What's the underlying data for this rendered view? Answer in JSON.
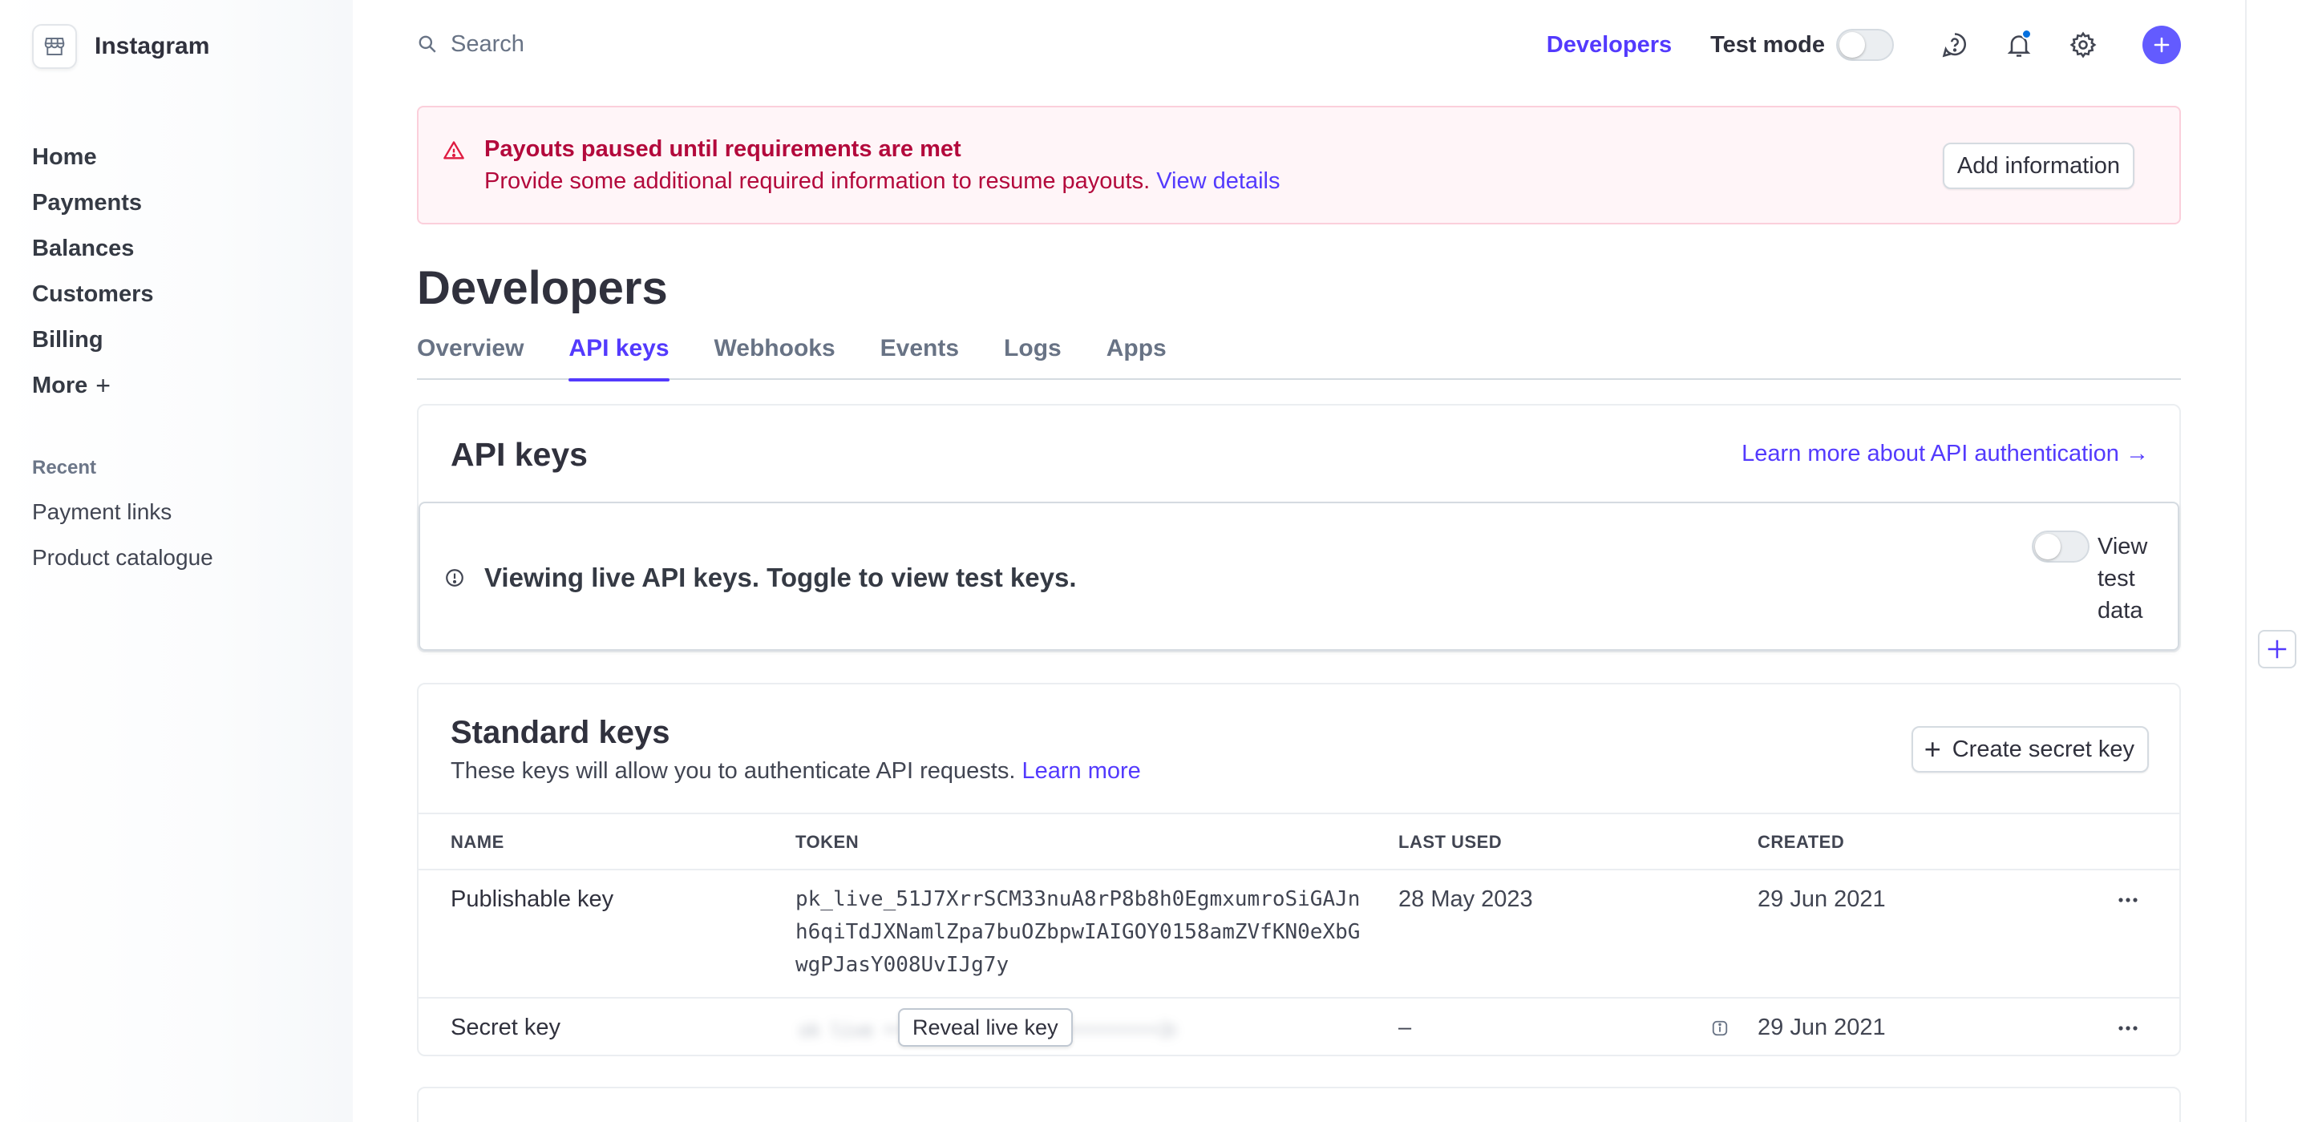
{
  "brand": {
    "name": "Instagram",
    "logo_icon": "store-icon"
  },
  "sidebar": {
    "items": [
      {
        "label": "Home"
      },
      {
        "label": "Payments"
      },
      {
        "label": "Balances"
      },
      {
        "label": "Customers"
      },
      {
        "label": "Billing"
      },
      {
        "label": "More"
      }
    ],
    "more_suffix": "+",
    "recent_label": "Recent",
    "recent": [
      {
        "label": "Payment links"
      },
      {
        "label": "Product catalogue"
      }
    ]
  },
  "topbar": {
    "search_placeholder": "Search",
    "developers_link": "Developers",
    "test_mode_label": "Test mode",
    "test_mode_on": false
  },
  "alert": {
    "title": "Payouts paused until requirements are met",
    "description": "Provide some additional required information to resume payouts.",
    "link": "View details",
    "button": "Add information"
  },
  "page": {
    "title": "Developers",
    "tabs": [
      {
        "label": "Overview",
        "active": false
      },
      {
        "label": "API keys",
        "active": true
      },
      {
        "label": "Webhooks",
        "active": false
      },
      {
        "label": "Events",
        "active": false
      },
      {
        "label": "Logs",
        "active": false
      },
      {
        "label": "Apps",
        "active": false
      }
    ]
  },
  "api_keys": {
    "title": "API keys",
    "learn_more": "Learn more about API authentication →",
    "notice": "Viewing live API keys. Toggle to view test keys.",
    "view_test_data_label": "View test data",
    "view_test_data_on": false
  },
  "standard_keys": {
    "title": "Standard keys",
    "subtitle": "These keys will allow you to authenticate API requests.",
    "subtitle_link": "Learn more",
    "create_button": "Create secret key",
    "columns": {
      "name": "NAME",
      "token": "TOKEN",
      "last_used": "LAST USED",
      "created": "CREATED"
    },
    "rows": [
      {
        "name": "Publishable key",
        "token": "pk_live_51J7XrrSCM33nuA8rP8b8h0EgmxumroSiGAJnh6qiTdJXNamlZpa7buOZbpwIAIGOY0158amZVfKN0eXbGwgPJasY008UvIJg7y",
        "last_used": "28 May 2023",
        "created": "29 Jun 2021"
      },
      {
        "name": "Secret key",
        "masked_token": "sk_live_••••••••••••••••••••••••••2mN8w",
        "reveal_button": "Reveal live key",
        "last_used": "–",
        "created": "29 Jun 2021"
      }
    ]
  },
  "colors": {
    "accent": "#533afd",
    "alert_text": "#b3093c",
    "alert_bg": "#fff5f8"
  }
}
